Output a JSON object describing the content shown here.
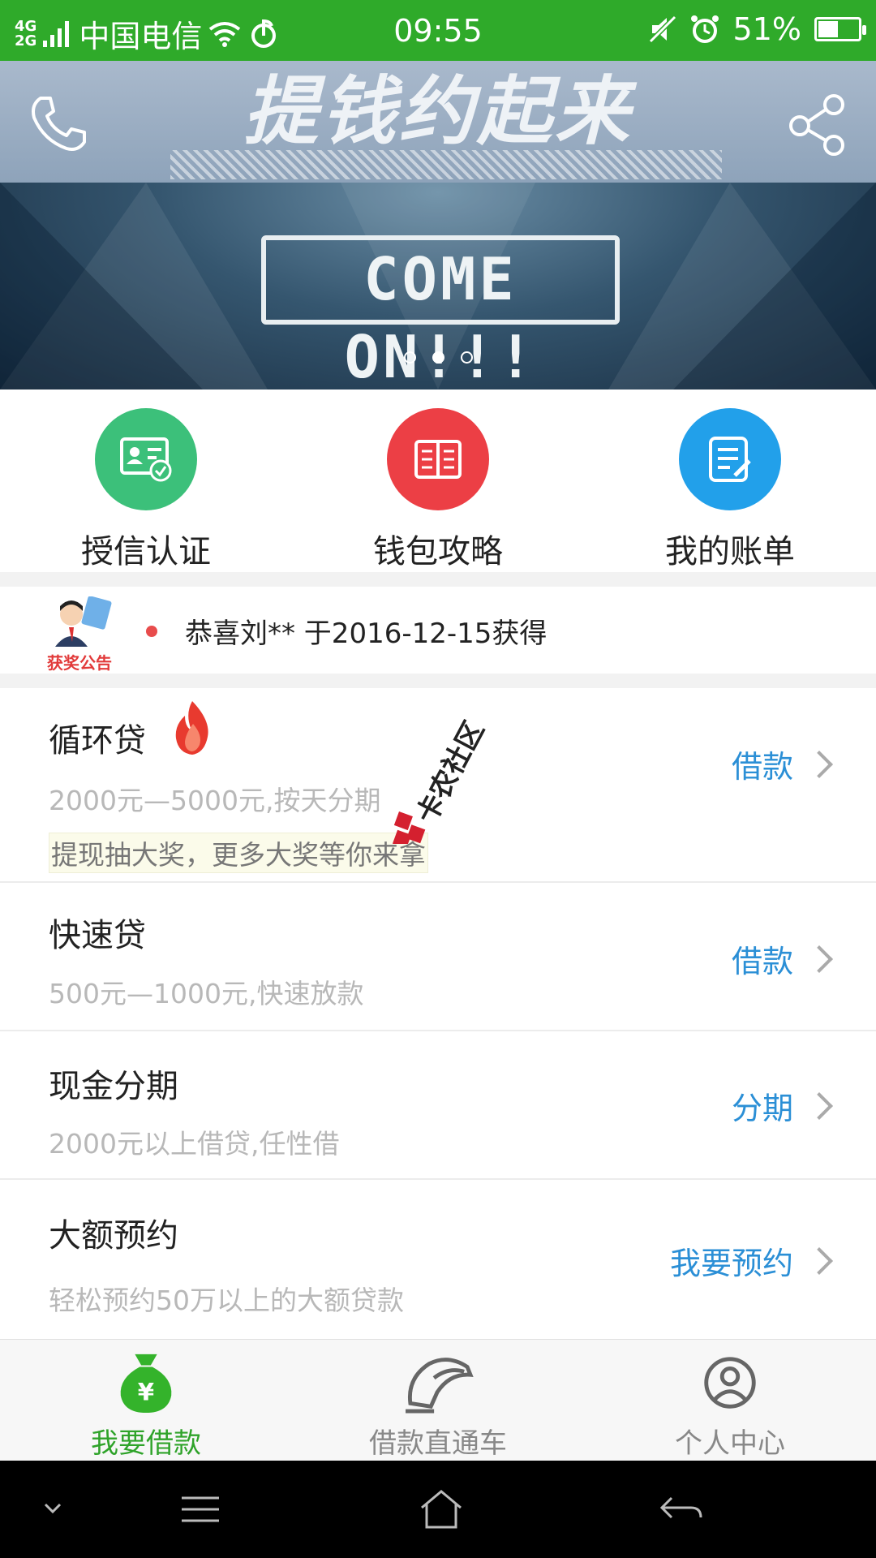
{
  "status_bar": {
    "network_top": "4G",
    "network_bottom": "2G",
    "carrier": "中国电信",
    "time": "09:55",
    "battery": "51%",
    "battery_level": 0.51
  },
  "banner": {
    "title": "提钱约起来",
    "sign_text": "COME ON!!!",
    "slides": 3,
    "active_slide": 2
  },
  "quick_links": [
    {
      "label": "授信认证",
      "color": "#3cc07a",
      "icon": "id-card-check-icon"
    },
    {
      "label": "钱包攻略",
      "color": "#ec3f45",
      "icon": "book-icon"
    },
    {
      "label": "我的账单",
      "color": "#22a0ea",
      "icon": "bill-icon"
    }
  ],
  "notice": {
    "logo_text": "获奖公告",
    "text": "恭喜刘** 于2016-12-15获得"
  },
  "products": [
    {
      "title": "循环贷",
      "subtitle": "2000元—5000元,按天分期",
      "promo": "提现抽大奖，更多大奖等你来拿",
      "action": "借款"
    },
    {
      "title": "快速贷",
      "subtitle": "500元—1000元,快速放款",
      "action": "借款"
    },
    {
      "title": "现金分期",
      "subtitle": "2000元以上借贷,任性借",
      "action": "分期"
    },
    {
      "title": "大额预约",
      "subtitle": "轻松预约50万以上的大额贷款",
      "action": "我要预约"
    }
  ],
  "watermark": "卡农社区",
  "tabs": [
    {
      "label": "我要借款",
      "active": true,
      "icon": "money-bag-icon"
    },
    {
      "label": "借款直通车",
      "active": false,
      "icon": "train-icon"
    },
    {
      "label": "个人中心",
      "active": false,
      "icon": "user-icon"
    }
  ],
  "colors": {
    "status_bar": "#2faa2a",
    "accent_blue": "#2b8fd6",
    "active_tab": "#2fa32a"
  }
}
